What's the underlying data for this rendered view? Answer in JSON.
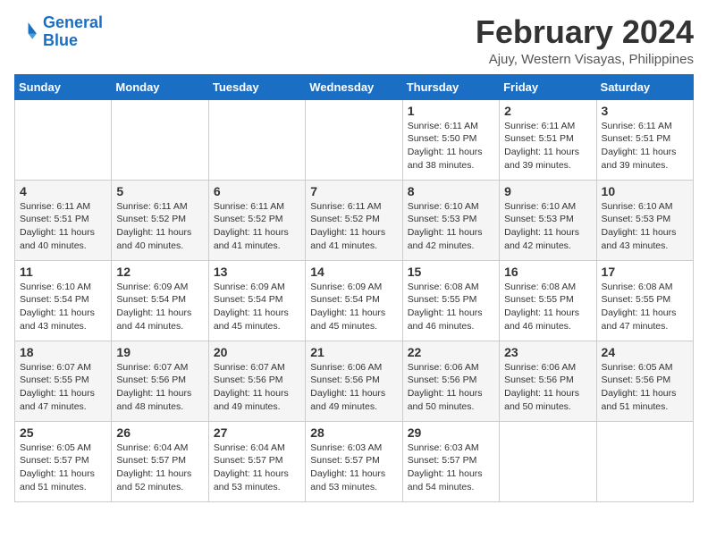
{
  "header": {
    "logo_line1": "General",
    "logo_line2": "Blue",
    "title": "February 2024",
    "subtitle": "Ajuy, Western Visayas, Philippines"
  },
  "weekdays": [
    "Sunday",
    "Monday",
    "Tuesday",
    "Wednesday",
    "Thursday",
    "Friday",
    "Saturday"
  ],
  "weeks": [
    [
      {
        "day": "",
        "info": ""
      },
      {
        "day": "",
        "info": ""
      },
      {
        "day": "",
        "info": ""
      },
      {
        "day": "",
        "info": ""
      },
      {
        "day": "1",
        "info": "Sunrise: 6:11 AM\nSunset: 5:50 PM\nDaylight: 11 hours\nand 38 minutes."
      },
      {
        "day": "2",
        "info": "Sunrise: 6:11 AM\nSunset: 5:51 PM\nDaylight: 11 hours\nand 39 minutes."
      },
      {
        "day": "3",
        "info": "Sunrise: 6:11 AM\nSunset: 5:51 PM\nDaylight: 11 hours\nand 39 minutes."
      }
    ],
    [
      {
        "day": "4",
        "info": "Sunrise: 6:11 AM\nSunset: 5:51 PM\nDaylight: 11 hours\nand 40 minutes."
      },
      {
        "day": "5",
        "info": "Sunrise: 6:11 AM\nSunset: 5:52 PM\nDaylight: 11 hours\nand 40 minutes."
      },
      {
        "day": "6",
        "info": "Sunrise: 6:11 AM\nSunset: 5:52 PM\nDaylight: 11 hours\nand 41 minutes."
      },
      {
        "day": "7",
        "info": "Sunrise: 6:11 AM\nSunset: 5:52 PM\nDaylight: 11 hours\nand 41 minutes."
      },
      {
        "day": "8",
        "info": "Sunrise: 6:10 AM\nSunset: 5:53 PM\nDaylight: 11 hours\nand 42 minutes."
      },
      {
        "day": "9",
        "info": "Sunrise: 6:10 AM\nSunset: 5:53 PM\nDaylight: 11 hours\nand 42 minutes."
      },
      {
        "day": "10",
        "info": "Sunrise: 6:10 AM\nSunset: 5:53 PM\nDaylight: 11 hours\nand 43 minutes."
      }
    ],
    [
      {
        "day": "11",
        "info": "Sunrise: 6:10 AM\nSunset: 5:54 PM\nDaylight: 11 hours\nand 43 minutes."
      },
      {
        "day": "12",
        "info": "Sunrise: 6:09 AM\nSunset: 5:54 PM\nDaylight: 11 hours\nand 44 minutes."
      },
      {
        "day": "13",
        "info": "Sunrise: 6:09 AM\nSunset: 5:54 PM\nDaylight: 11 hours\nand 45 minutes."
      },
      {
        "day": "14",
        "info": "Sunrise: 6:09 AM\nSunset: 5:54 PM\nDaylight: 11 hours\nand 45 minutes."
      },
      {
        "day": "15",
        "info": "Sunrise: 6:08 AM\nSunset: 5:55 PM\nDaylight: 11 hours\nand 46 minutes."
      },
      {
        "day": "16",
        "info": "Sunrise: 6:08 AM\nSunset: 5:55 PM\nDaylight: 11 hours\nand 46 minutes."
      },
      {
        "day": "17",
        "info": "Sunrise: 6:08 AM\nSunset: 5:55 PM\nDaylight: 11 hours\nand 47 minutes."
      }
    ],
    [
      {
        "day": "18",
        "info": "Sunrise: 6:07 AM\nSunset: 5:55 PM\nDaylight: 11 hours\nand 47 minutes."
      },
      {
        "day": "19",
        "info": "Sunrise: 6:07 AM\nSunset: 5:56 PM\nDaylight: 11 hours\nand 48 minutes."
      },
      {
        "day": "20",
        "info": "Sunrise: 6:07 AM\nSunset: 5:56 PM\nDaylight: 11 hours\nand 49 minutes."
      },
      {
        "day": "21",
        "info": "Sunrise: 6:06 AM\nSunset: 5:56 PM\nDaylight: 11 hours\nand 49 minutes."
      },
      {
        "day": "22",
        "info": "Sunrise: 6:06 AM\nSunset: 5:56 PM\nDaylight: 11 hours\nand 50 minutes."
      },
      {
        "day": "23",
        "info": "Sunrise: 6:06 AM\nSunset: 5:56 PM\nDaylight: 11 hours\nand 50 minutes."
      },
      {
        "day": "24",
        "info": "Sunrise: 6:05 AM\nSunset: 5:56 PM\nDaylight: 11 hours\nand 51 minutes."
      }
    ],
    [
      {
        "day": "25",
        "info": "Sunrise: 6:05 AM\nSunset: 5:57 PM\nDaylight: 11 hours\nand 51 minutes."
      },
      {
        "day": "26",
        "info": "Sunrise: 6:04 AM\nSunset: 5:57 PM\nDaylight: 11 hours\nand 52 minutes."
      },
      {
        "day": "27",
        "info": "Sunrise: 6:04 AM\nSunset: 5:57 PM\nDaylight: 11 hours\nand 53 minutes."
      },
      {
        "day": "28",
        "info": "Sunrise: 6:03 AM\nSunset: 5:57 PM\nDaylight: 11 hours\nand 53 minutes."
      },
      {
        "day": "29",
        "info": "Sunrise: 6:03 AM\nSunset: 5:57 PM\nDaylight: 11 hours\nand 54 minutes."
      },
      {
        "day": "",
        "info": ""
      },
      {
        "day": "",
        "info": ""
      }
    ]
  ]
}
